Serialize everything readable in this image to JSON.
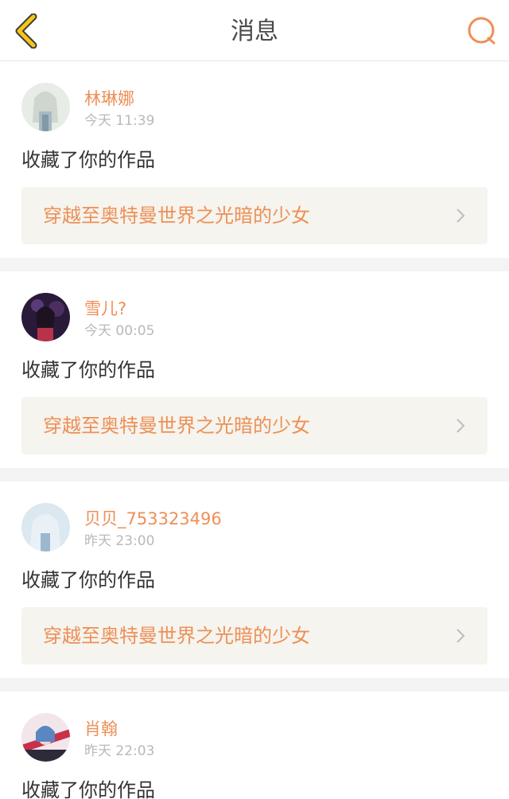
{
  "header": {
    "title": "消息",
    "back_icon": "chevron-left-icon",
    "search_icon": "search-icon"
  },
  "colors": {
    "accent": "#ee8f56",
    "back_icon": "#f5c518",
    "card_bg": "#f5f4ee",
    "separator": "#f4f4f4",
    "time_text": "#b9b9b9"
  },
  "messages": [
    {
      "username": "林琳娜",
      "time": "今天 11:39",
      "action": "收藏了你的作品",
      "work_title": "穿越至奥特曼世界之光暗的少女"
    },
    {
      "username": "雪儿?",
      "time": "今天 00:05",
      "action": "收藏了你的作品",
      "work_title": "穿越至奥特曼世界之光暗的少女"
    },
    {
      "username": "贝贝_753323496",
      "time": "昨天 23:00",
      "action": "收藏了你的作品",
      "work_title": "穿越至奥特曼世界之光暗的少女"
    },
    {
      "username": "肖翰",
      "time": "昨天 22:03",
      "action": "收藏了你的作品",
      "work_title": ""
    }
  ]
}
